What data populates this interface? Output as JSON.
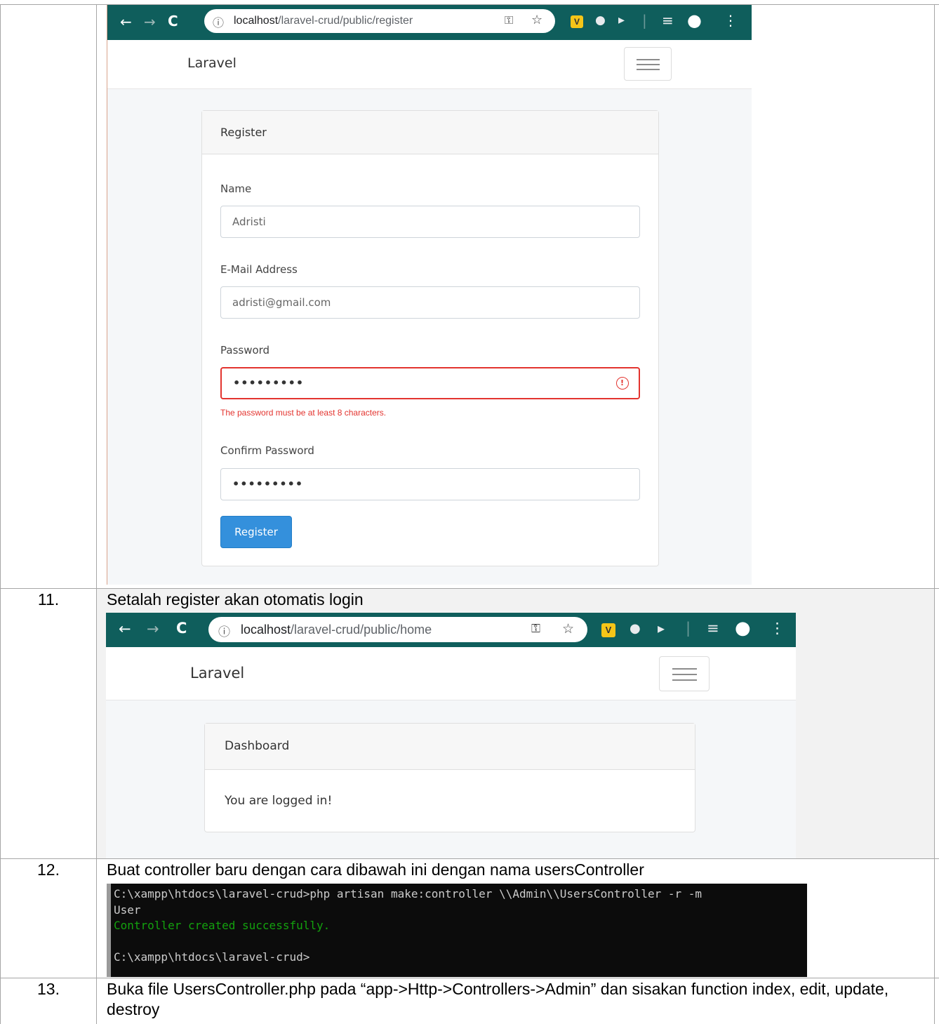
{
  "rows": {
    "row10": {
      "number": ""
    },
    "row11": {
      "number": "11.",
      "text": "Setalah register akan otomatis login"
    },
    "row12": {
      "number": "12.",
      "text": "Buat controller baru dengan cara dibawah ini dengan nama usersController"
    },
    "row13": {
      "number": "13.",
      "text": "Buka file UsersController.php pada “app->Http->Controllers->Admin” dan sisakan function index, edit, update, destroy"
    }
  },
  "screenshot_register": {
    "url_host": "localhost",
    "url_path": "/laravel-crud/public/register",
    "brand": "Laravel",
    "card_title": "Register",
    "fields": {
      "name_label": "Name",
      "name_value": "Adristi",
      "email_label": "E-Mail Address",
      "email_value": "adristi@gmail.com",
      "password_label": "Password",
      "password_value": "•••••••••",
      "password_error": "The password must be at least 8 characters.",
      "confirm_label": "Confirm Password",
      "confirm_value": "•••••••••"
    },
    "submit_label": "Register"
  },
  "screenshot_home": {
    "url_host": "localhost",
    "url_path": "/laravel-crud/public/home",
    "brand": "Laravel",
    "card_title": "Dashboard",
    "card_body": "You are logged in!"
  },
  "terminal": {
    "line1": "C:\\xampp\\htdocs\\laravel-crud>php artisan make:controller \\\\Admin\\\\UsersController -r -m",
    "line2": "User",
    "line3": "Controller created successfully.",
    "line4": "",
    "line5": "C:\\xampp\\htdocs\\laravel-crud>"
  },
  "icons": {
    "back": "←",
    "forward": "→",
    "reload": "C",
    "info": "ⓘ",
    "key": "⚿",
    "star": "☆",
    "globe": "●",
    "play": "▸",
    "divider": "|",
    "queue": "≡",
    "account": "●",
    "more": "⋮",
    "alert": "!"
  },
  "colors": {
    "chrome": "#0f5e5c",
    "primary_button": "#3490dc",
    "error": "#e3342f",
    "terminal_ok": "#13a10e"
  }
}
